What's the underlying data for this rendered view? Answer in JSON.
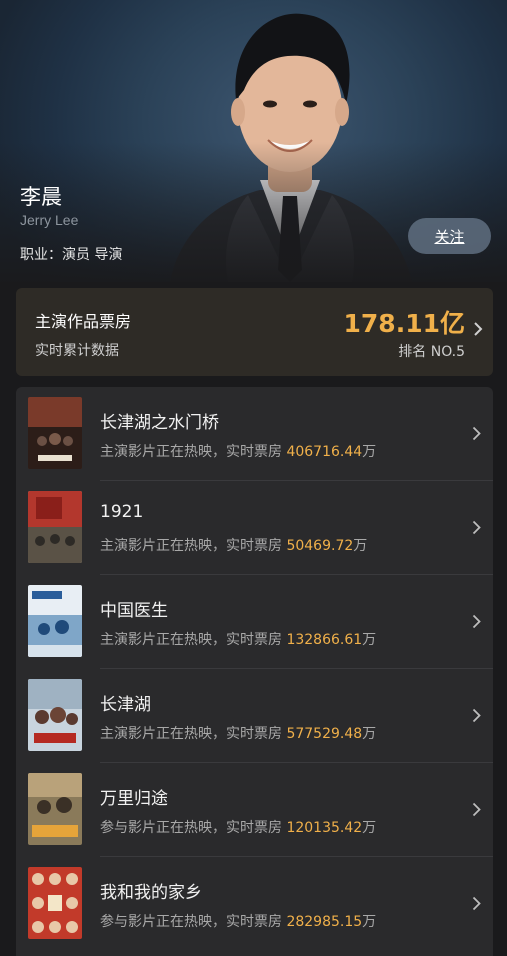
{
  "profile": {
    "name": "李晨",
    "english_name": "Jerry Lee",
    "occupation": "职业：演员 导演",
    "follow_label": "关注"
  },
  "box_office": {
    "title": "主演作品票房",
    "subtitle": "实时累计数据",
    "amount": "178.11亿",
    "rank": "排名 NO.5"
  },
  "colors": {
    "accent": "#f0b04a",
    "card": "#2a2a2c",
    "box_card": "#2e2b26"
  },
  "movies": [
    {
      "title": "长津湖之水门桥",
      "desc_prefix": "主演影片正在热映，实时票房",
      "box": "406716.44",
      "unit": "万"
    },
    {
      "title": "1921",
      "desc_prefix": "主演影片正在热映，实时票房",
      "box": "50469.72",
      "unit": "万"
    },
    {
      "title": "中国医生",
      "desc_prefix": "主演影片正在热映，实时票房",
      "box": "132866.61",
      "unit": "万"
    },
    {
      "title": "长津湖",
      "desc_prefix": "主演影片正在热映，实时票房",
      "box": "577529.48",
      "unit": "万"
    },
    {
      "title": "万里归途",
      "desc_prefix": "参与影片正在热映，实时票房",
      "box": "120135.42",
      "unit": "万"
    },
    {
      "title": "我和我的家乡",
      "desc_prefix": "参与影片正在热映，实时票房",
      "box": "282985.15",
      "unit": "万"
    }
  ]
}
